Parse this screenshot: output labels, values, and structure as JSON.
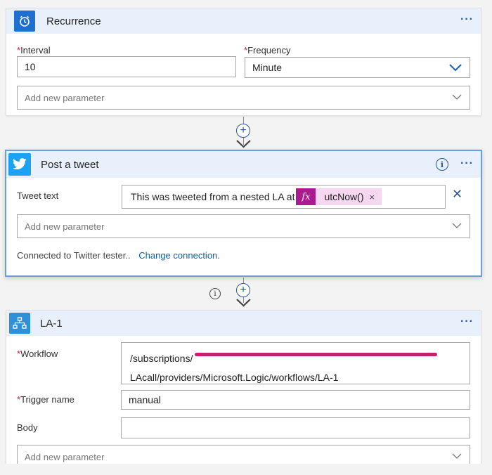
{
  "recurrence": {
    "title": "Recurrence",
    "menu": "···",
    "interval_label": "Interval",
    "interval_value": "10",
    "frequency_label": "Frequency",
    "frequency_value": "Minute",
    "add_param": "Add new parameter",
    "required_mark": "*"
  },
  "tweet": {
    "title": "Post a tweet",
    "menu": "···",
    "info": "i",
    "tweet_text_label": "Tweet text",
    "tweet_text_value": "This was tweeted from a nested LA at",
    "fx_label": "fx",
    "token_label": "utcNow()",
    "token_remove": "×",
    "clear_field": "✕",
    "add_param": "Add new parameter",
    "connected_text": "Connected to Twitter tester..",
    "change_connection": "Change connection."
  },
  "connector": {
    "plus": "+",
    "info": "i"
  },
  "la1": {
    "title": "LA-1",
    "menu": "···",
    "workflow_label": "Workflow",
    "workflow_line1": "/subscriptions/",
    "workflow_line2": "LAcall/providers/Microsoft.Logic/workflows/LA-1",
    "trigger_label": "Trigger name",
    "trigger_value": "manual",
    "body_label": "Body",
    "body_value": "",
    "add_param": "Add new parameter",
    "required_mark": "*"
  },
  "colors": {
    "recurrence_icon": "#1f6fd1",
    "twitter_icon": "#1da1f2",
    "la_icon": "#2f8fd8",
    "header_bg": "#e8f1fb",
    "token_fx": "#ab1a8e",
    "link": "#0b5ea8"
  }
}
